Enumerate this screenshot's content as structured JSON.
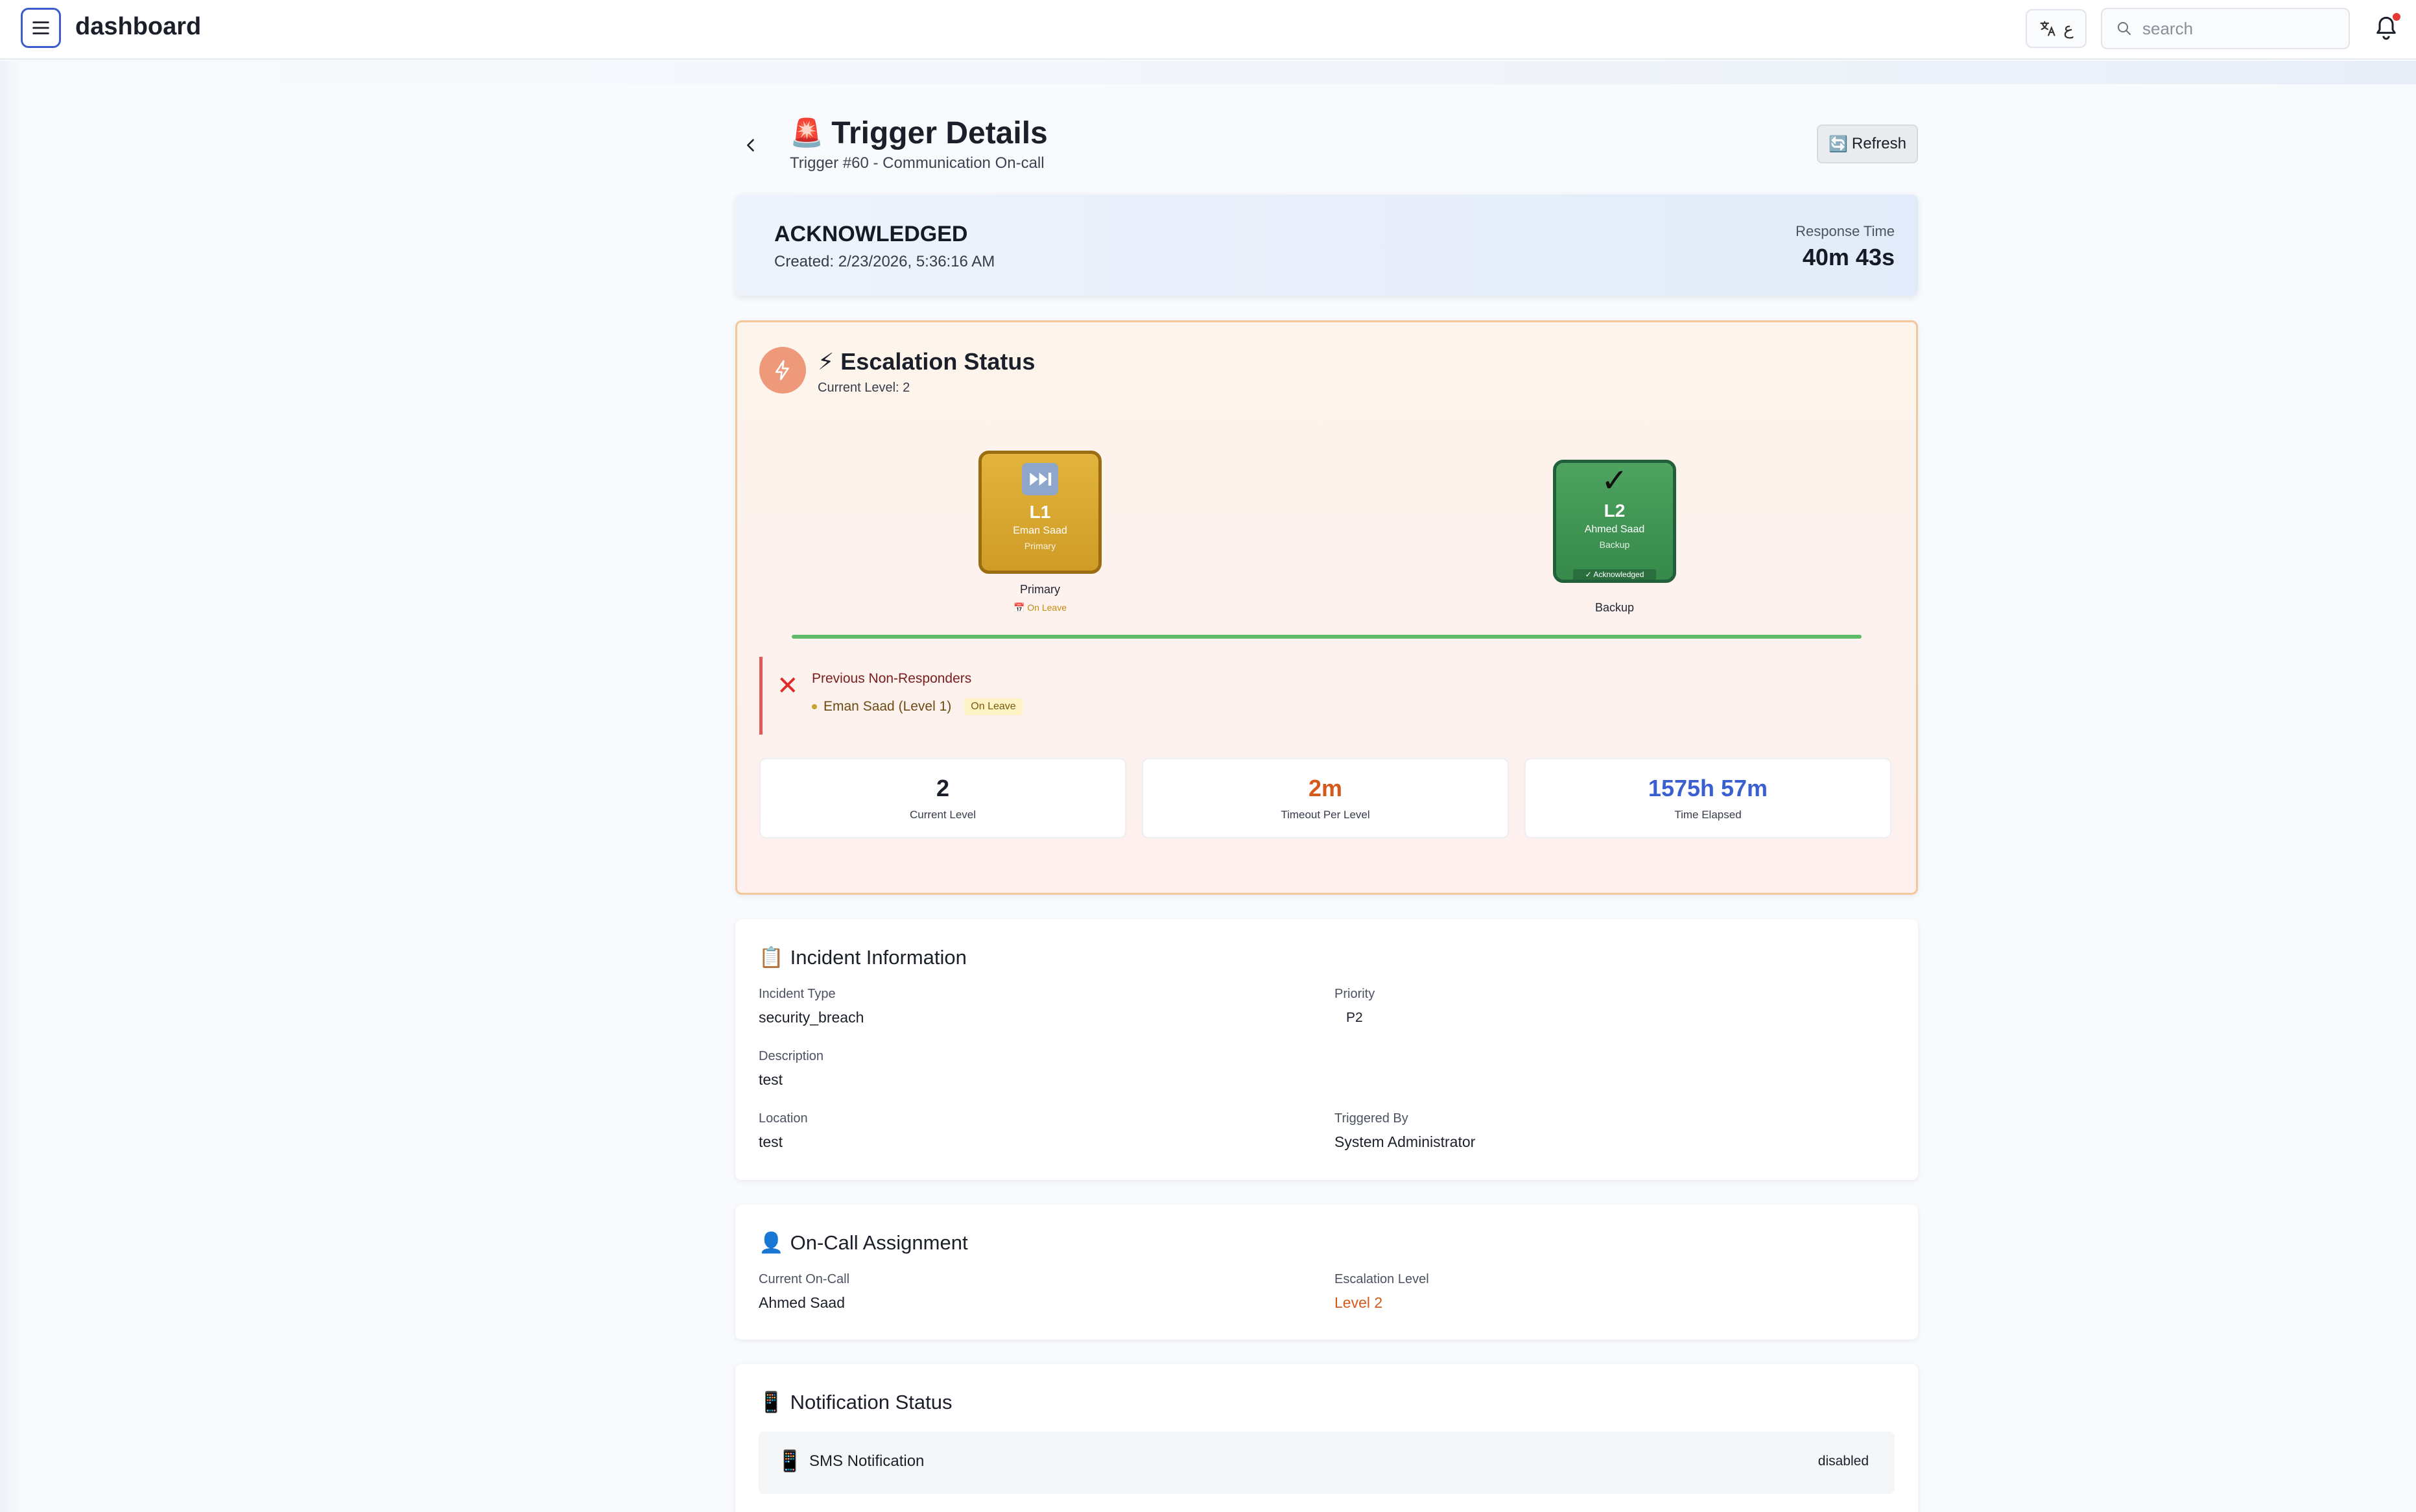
{
  "topbar": {
    "app_title": "dashboard",
    "lang_label": "ع",
    "search_placeholder": "search"
  },
  "header": {
    "title": "Trigger Details",
    "subtitle": "Trigger #60 - Communication On-call",
    "refresh_label": "Refresh"
  },
  "status": {
    "state": "ACKNOWLEDGED",
    "created": "Created: 2/23/2026, 5:36:16 AM",
    "response_time_label": "Response Time",
    "response_time_value": "40m 43s"
  },
  "escalation": {
    "title": "Escalation Status",
    "current_level_text": "Current Level: 2",
    "levels": [
      {
        "name": "L1",
        "person": "Eman Saad",
        "role": "Primary",
        "caption": "Primary",
        "tag": "On Leave",
        "state": "skipped",
        "color": "#cf9c26"
      },
      {
        "name": "L2",
        "person": "Ahmed Saad",
        "role": "Backup",
        "caption": "Backup",
        "tag": "✓ Acknowledged",
        "state": "acknowledged",
        "color": "#35894a"
      }
    ],
    "non_responders_title": "Previous Non-Responders",
    "non_responders": [
      {
        "text": "Eman Saad (Level 1)",
        "tag": "On Leave"
      }
    ],
    "stats": [
      {
        "value": "2",
        "label": "Current Level",
        "color": "#1b1f2a"
      },
      {
        "value": "2m",
        "label": "Timeout Per Level",
        "color": "#d45a1c"
      },
      {
        "value": "1575h 57m",
        "label": "Time Elapsed",
        "color": "#3a5fd0"
      }
    ]
  },
  "incident": {
    "title": "Incident Information",
    "type_label": "Incident Type",
    "type_value": "security_breach",
    "priority_label": "Priority",
    "priority_value": "P2",
    "description_label": "Description",
    "description_value": "test",
    "location_label": "Location",
    "location_value": "test",
    "triggered_by_label": "Triggered By",
    "triggered_by_value": "System Administrator"
  },
  "oncall": {
    "title": "On-Call Assignment",
    "current_label": "Current On-Call",
    "current_value": "Ahmed Saad",
    "level_label": "Escalation Level",
    "level_value": "Level 2",
    "level_color": "#d45a1c"
  },
  "notifications": {
    "title": "Notification Status",
    "items": [
      {
        "label": "SMS Notification",
        "status": "disabled"
      }
    ]
  },
  "colors": {
    "accent": "#3b5ccc",
    "success": "#5dbb6a",
    "danger": "#e02b2b",
    "warning": "#cf9c26"
  }
}
